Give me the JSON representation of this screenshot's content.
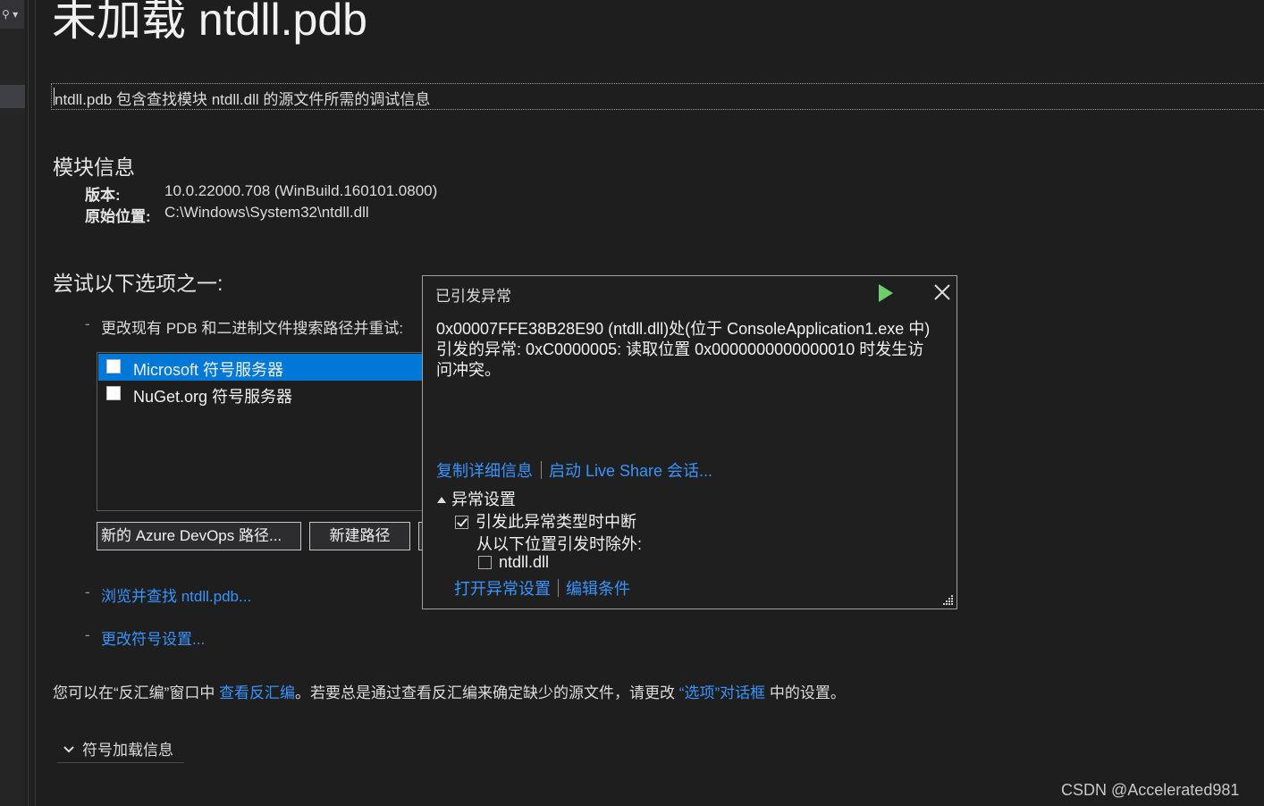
{
  "gutter": {
    "button_glyph": "⚲ ▾"
  },
  "page": {
    "title": "未加载 ntdll.pdb",
    "description": "ntdll.pdb 包含查找模块 ntdll.dll 的源文件所需的调试信息"
  },
  "module_info": {
    "heading": "模块信息",
    "version_label": "版本:",
    "version_value": "10.0.22000.708 (WinBuild.160101.0800)",
    "location_label": "原始位置:",
    "location_value": "C:\\Windows\\System32\\ntdll.dll"
  },
  "options": {
    "heading": "尝试以下选项之一:",
    "dash": "-",
    "change_paths_text": "更改现有 PDB 和二进制文件搜索路径并重试:",
    "servers": [
      {
        "label": "Microsoft 符号服务器",
        "checked": false,
        "selected": true
      },
      {
        "label": "NuGet.org 符号服务器",
        "checked": false,
        "selected": false
      }
    ],
    "btn_azure": "新的 Azure DevOps 路径...",
    "btn_new_path": "新建路径",
    "browse_link": "浏览并查找 ntdll.pdb...",
    "symbol_settings_link": "更改符号设置..."
  },
  "disasm": {
    "pre": "您可以在“反汇编”窗口中 ",
    "link1": "查看反汇编",
    "mid": "。若要总是通过查看反汇编来确定缺少的源文件，请更改 ",
    "link2": "“选项”对话框",
    "post": " 中的设置。"
  },
  "symbol_load": {
    "label": "符号加载信息"
  },
  "exception_popup": {
    "title": "已引发异常",
    "message": "0x00007FFE38B28E90 (ntdll.dll)处(位于 ConsoleApplication1.exe 中)引发的异常: 0xC0000005: 读取位置 0x0000000000000010 时发生访问冲突。",
    "copy_details": "复制详细信息",
    "live_share": "启动 Live Share 会话...",
    "section": "异常设置",
    "break_label": "引发此异常类型时中断",
    "break_checked": true,
    "except_label": "从以下位置引发时除外:",
    "module_label": "ntdll.dll",
    "module_checked": false,
    "open_settings": "打开异常设置",
    "edit_conditions": "编辑条件",
    "colors": {
      "play": "#6ccf6c",
      "link": "#3794ff"
    }
  },
  "watermark": "CSDN @Accelerated981"
}
